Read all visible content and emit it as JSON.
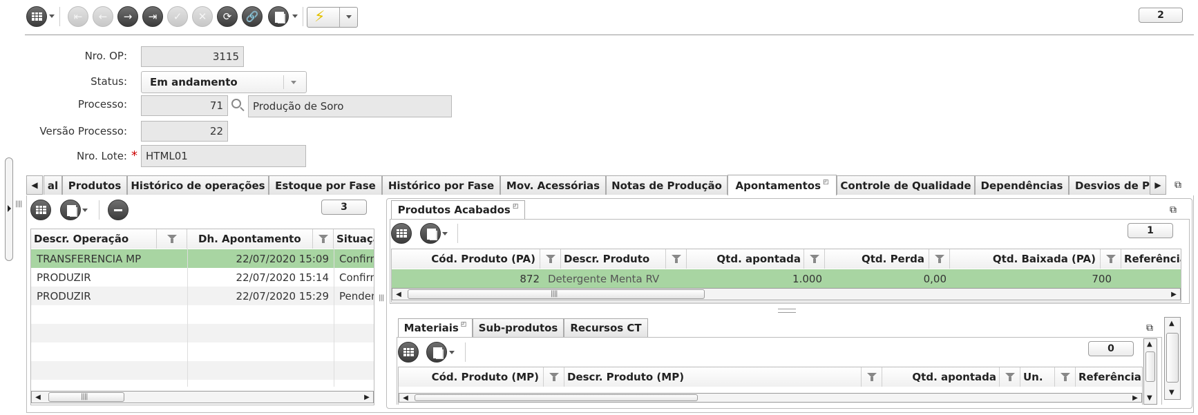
{
  "toolbar": {
    "record_count": "2",
    "buttons": [
      "grid-icon",
      "first-icon",
      "prev-icon",
      "next-icon",
      "last-icon",
      "confirm-icon",
      "cancel-icon",
      "refresh-icon",
      "link-icon",
      "clone-icon",
      "lightning-icon"
    ]
  },
  "form": {
    "nro_op": {
      "label": "Nro. OP:",
      "value": "3115"
    },
    "status": {
      "label": "Status:",
      "value": "Em andamento"
    },
    "processo": {
      "label": "Processo:",
      "code": "71",
      "description": "Produção de Soro"
    },
    "versao": {
      "label": "Versão Processo:",
      "value": "22"
    },
    "lote": {
      "label": "Nro. Lote:",
      "required": "*",
      "value": "HTML01"
    }
  },
  "tabs": [
    "al",
    "Produtos",
    "Histórico de operações",
    "Estoque por Fase",
    "Histórico por Fase",
    "Mov. Acessórias",
    "Notas de Produção",
    "Apontamentos",
    "Controle de Qualidade",
    "Dependências",
    "Desvios de P"
  ],
  "apontamentos": {
    "count": "3",
    "columns": [
      "Descr. Operação",
      "Dh. Apontamento",
      "Situação"
    ],
    "rows": [
      [
        "TRANSFERENCIA MP",
        "22/07/2020 15:09",
        "Confirmado"
      ],
      [
        "PRODUZIR",
        "22/07/2020 15:14",
        "Confirmado"
      ],
      [
        "PRODUZIR",
        "22/07/2020 15:29",
        "Pendente"
      ]
    ]
  },
  "produtos_acabados": {
    "tab": "Produtos Acabados",
    "count": "1",
    "columns": [
      "Cód. Produto (PA)",
      "Descr. Produto",
      "Qtd. apontada",
      "Qtd. Perda",
      "Qtd. Baixada (PA)",
      "Referência do Pro"
    ],
    "rows": [
      [
        "872",
        "Detergente Menta RV",
        "1.000",
        "0,00",
        "700",
        ""
      ]
    ]
  },
  "sub_tabs": [
    "Materiais",
    "Sub-produtos",
    "Recursos CT"
  ],
  "materiais": {
    "count": "0",
    "columns": [
      "Cód. Produto (MP)",
      "Descr. Produto (MP)",
      "Qtd. apontada",
      "Un.",
      "Referência"
    ]
  },
  "colors": {
    "selected_row": "#a8d5a2",
    "alt_row": "#f2f2f2",
    "required": "#cc0000"
  }
}
